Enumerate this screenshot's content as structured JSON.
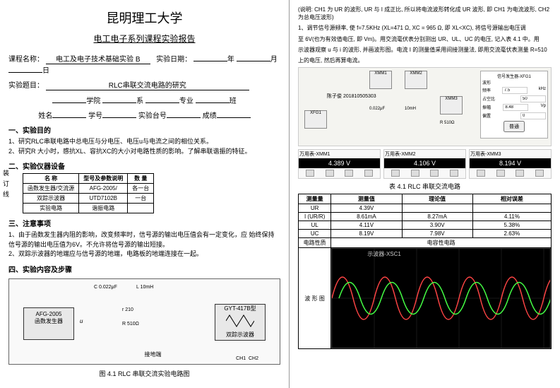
{
  "header": {
    "university": "昆明理工大学",
    "report_title": "电工电子系列课程实验报告"
  },
  "form": {
    "course_label": "课程名称：",
    "course_value": "电工及电子技术基础实验 B",
    "date_label": "实验日期：",
    "year": "年",
    "month": "月",
    "day": "日",
    "topic_label": "实验题目：",
    "topic_value": "RLC串联交流电路的研究",
    "college": "学院",
    "dept": "系",
    "major": "专业",
    "class": "班",
    "name_label": "姓名",
    "id_label": "学号",
    "bench_label": "实验台号",
    "score_label": "成绩"
  },
  "side_note": "装订线",
  "sections": {
    "s1_title": "一、实验目的",
    "s1_items": [
      "1、研究RLC串联电路中总电压与分电压、电压u与电流之间的相位关系。",
      "2、研究R 大小时，感抗XL、容抗XC的大小对电路性质的影响。了解串联谐振的特征。"
    ],
    "s2_title": "二、实验仪器设备",
    "s3_title": "三、注意事项",
    "s3_items": [
      "1、由于函数发生器内阻的影响，改变频率时，信号源的输出电压值会有一定变化，应 始终保持信号源的输出电压值为6V。不允许将信号源的输出短接。",
      "2、双踪示波器的地端应与信号源的地端，电路板的地端连接在一起。"
    ],
    "s4_title": "四、实验内容及步骤"
  },
  "equipment": {
    "headers": [
      "名 称",
      "型号及参数说明",
      "数 量"
    ],
    "rows": [
      [
        "函数发生器/交流源",
        "AFG-2005/",
        "各一台"
      ],
      [
        "双踪示波器",
        "UTD7102B",
        "一台"
      ],
      [
        "实验电路",
        "谐振电路",
        ""
      ]
    ]
  },
  "circuit": {
    "afg_model": "AFG-2005",
    "afg_label": "函数发生器",
    "gyt_model": "GYT-417B型",
    "gyt_label": "双踪示波器",
    "c_label": "C",
    "c_val": "0.022μF",
    "l_label": "L",
    "l_val": "10mH",
    "r_label": "r 210",
    "r2_label": "R 510Ω",
    "u_label": "u",
    "gnd": "接地端",
    "ch1": "CH1",
    "ch2": "CH2",
    "caption": "图 4.1 RLC 串联交流实验电路图"
  },
  "right_desc": {
    "line1": "(说明: CH1 为 UR 的波形, UR 与 I 成正比, 所以将电流波形转化成 UR 波形, 即 CH1 为电流波形, CH2 为总电压波形)",
    "line2": "1、调节信号源频率, 使 f=7.5KHz (XL=471 Ω, XC = 965 Ω, 即 XL<XC), 将信号源输出电压调",
    "line3": "至 6V(也为有效值电压, 即 Vm)。用交流毫伏表分别测出 UR、UL、UC 的电压, 记入表 4.1 中。用",
    "line4": "示波器观察 u 与 i 的波形, 并画波形图。电流 I 的测量值采用间接测量法, 即用交流毫伏表测量 R=510",
    "line5": "上的电压, 然后再算电流。"
  },
  "sim": {
    "xmm1": "XMM1",
    "xmm2": "XMM2",
    "xmm3": "XMM3",
    "xfg1": "XFG1",
    "student": "陈子俊 201810505303",
    "c_val": "0.022μF",
    "l_val": "10mH",
    "r_val": "R 510Ω"
  },
  "panel": {
    "title": "信号发生器-XFG1",
    "waveform": "波形",
    "freq_label": "频率",
    "freq_val": "7.5",
    "freq_unit": "kHz",
    "duty_label": "占空比",
    "duty_val": "50",
    "amp_label": "振幅",
    "amp_val": "8.48",
    "amp_unit": "Vp",
    "offset_label": "偏置",
    "offset_val": "0",
    "btn": "普通"
  },
  "meters": [
    {
      "name": "万用表-XMM1",
      "value": "4.389 V"
    },
    {
      "name": "万用表-XMM2",
      "value": "4.106 V"
    },
    {
      "name": "万用表-XMM3",
      "value": "8.194 V"
    }
  ],
  "table41": {
    "title": "表 4.1  RLC 串联交流电路",
    "headers": [
      "测量量",
      "测量值",
      "理论值",
      "相对误差"
    ],
    "rows": [
      [
        "UR",
        "4.39V",
        "",
        ""
      ],
      [
        "I (UR/R)",
        "8.61mA",
        "8.27mA",
        "4.11%"
      ],
      [
        "UL",
        "4.11V",
        "3.90V",
        "5.38%"
      ],
      [
        "UC",
        "8.19V",
        "7.98V",
        "2.63%"
      ],
      [
        "电路性质",
        "电容性电路",
        "",
        ""
      ]
    ],
    "wave_label": "波 形 图"
  },
  "scope": {
    "title": "示波器-XSC1"
  }
}
